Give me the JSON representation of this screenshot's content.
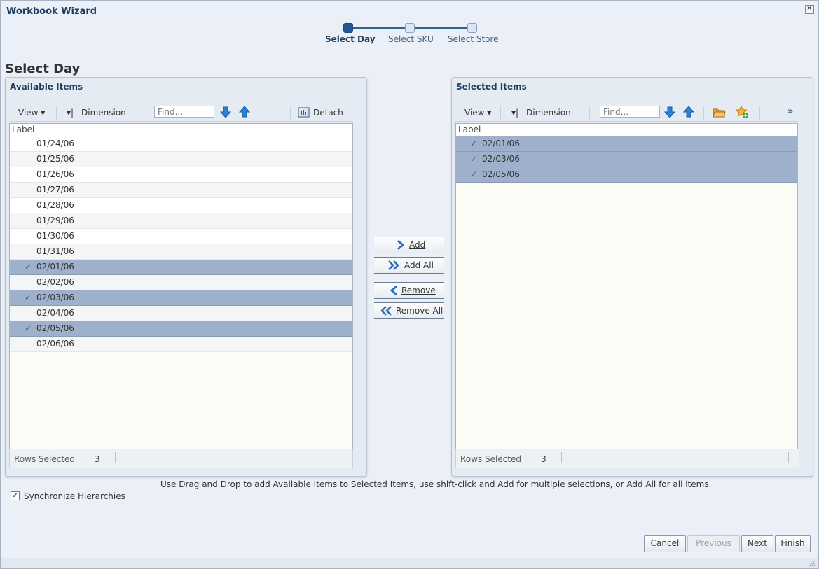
{
  "window": {
    "title": "Workbook Wizard",
    "close_symbol": "✕"
  },
  "train": {
    "steps": [
      {
        "label": "Select Day",
        "active": true
      },
      {
        "label": "Select SKU",
        "active": false
      },
      {
        "label": "Select Store",
        "active": false
      }
    ]
  },
  "page_title": "Select Day",
  "available": {
    "title": "Available Items",
    "toolbar": {
      "view": "View ▾",
      "dimension": "Dimension",
      "find_placeholder": "Find...",
      "detach": "Detach"
    },
    "column_header": "Label",
    "rows": [
      {
        "label": "01/24/06",
        "selected": false
      },
      {
        "label": "01/25/06",
        "selected": false
      },
      {
        "label": "01/26/06",
        "selected": false
      },
      {
        "label": "01/27/06",
        "selected": false
      },
      {
        "label": "01/28/06",
        "selected": false
      },
      {
        "label": "01/29/06",
        "selected": false
      },
      {
        "label": "01/30/06",
        "selected": false
      },
      {
        "label": "01/31/06",
        "selected": false
      },
      {
        "label": "02/01/06",
        "selected": true
      },
      {
        "label": "02/02/06",
        "selected": false
      },
      {
        "label": "02/03/06",
        "selected": true
      },
      {
        "label": "02/04/06",
        "selected": false
      },
      {
        "label": "02/05/06",
        "selected": true
      },
      {
        "label": "02/06/06",
        "selected": false
      }
    ],
    "status_label": "Rows Selected",
    "status_value": "3"
  },
  "selected": {
    "title": "Selected Items",
    "toolbar": {
      "view": "View ▾",
      "dimension": "Dimension",
      "find_placeholder": "Find...",
      "more": "»"
    },
    "column_header": "Label",
    "rows": [
      {
        "label": "02/01/06",
        "selected": true
      },
      {
        "label": "02/03/06",
        "selected": true
      },
      {
        "label": "02/05/06",
        "selected": true
      }
    ],
    "status_label": "Rows Selected",
    "status_value": "3"
  },
  "shuttle": {
    "add": "Add",
    "add_all": "Add All",
    "remove": "Remove",
    "remove_all": "Remove All"
  },
  "hint": "Use Drag and Drop to add Available Items to Selected Items, use shift-click and Add for multiple selections, or Add All for all items.",
  "sync": {
    "label": "Synchronize Hierarchies",
    "checked": true
  },
  "footer": {
    "cancel": "Cancel",
    "previous": "Previous",
    "next": "Next",
    "finish": "Finish"
  },
  "colors": {
    "accent": "#1f5a96",
    "selected_row": "#9fb0cc",
    "title": "#1f3d5c"
  }
}
